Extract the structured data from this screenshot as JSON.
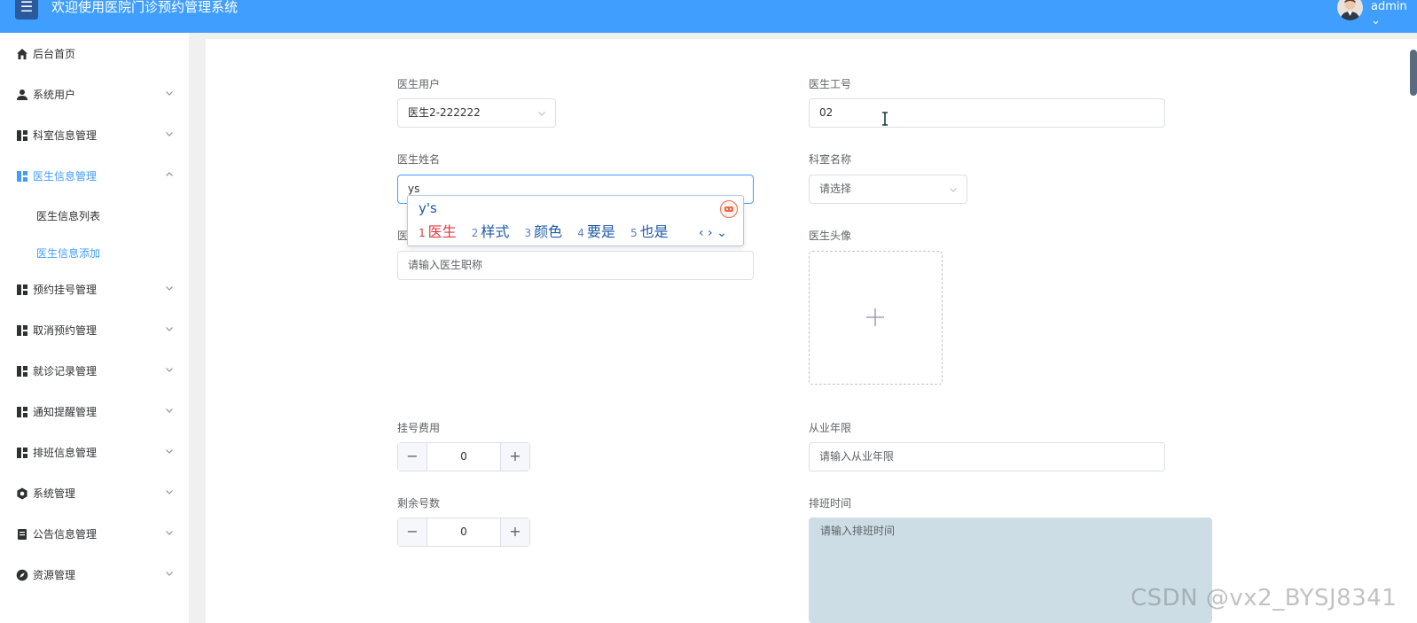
{
  "header": {
    "menu_icon": "☰",
    "title": "欢迎使用医院门诊预约管理系统",
    "user": "admin",
    "user_caret": "⌄"
  },
  "sidebar": {
    "items": [
      {
        "label": "后台首页",
        "icon": "home-icon"
      },
      {
        "label": "系统用户",
        "icon": "user-icon"
      },
      {
        "label": "科室信息管理",
        "icon": "grid-icon"
      },
      {
        "label": "医生信息管理",
        "icon": "grid-icon"
      },
      {
        "label": "预约挂号管理",
        "icon": "grid-icon"
      },
      {
        "label": "取消预约管理",
        "icon": "grid-icon"
      },
      {
        "label": "就诊记录管理",
        "icon": "grid-icon"
      },
      {
        "label": "通知提醒管理",
        "icon": "grid-icon"
      },
      {
        "label": "排班信息管理",
        "icon": "grid-icon"
      },
      {
        "label": "系统管理",
        "icon": "gear-icon"
      },
      {
        "label": "公告信息管理",
        "icon": "document-icon"
      },
      {
        "label": "资源管理",
        "icon": "compass-icon"
      }
    ],
    "sub_items": [
      {
        "label": "医生信息列表"
      },
      {
        "label": "医生信息添加"
      }
    ],
    "accent_color": "#409eff"
  },
  "form": {
    "doctor_user": {
      "label": "医生用户",
      "value": "医生2-222222"
    },
    "doctor_id": {
      "label": "医生工号",
      "value": "02"
    },
    "doctor_name": {
      "label": "医生姓名",
      "value": "ys"
    },
    "department": {
      "label": "科室名称",
      "placeholder": "请选择"
    },
    "doctor_title": {
      "label_partial": "医",
      "placeholder": "请输入医生职称"
    },
    "avatar": {
      "label": "医生头像",
      "plus": "+"
    },
    "fee": {
      "label": "挂号费用",
      "value": "0",
      "minus": "−",
      "plus": "+"
    },
    "years": {
      "label": "从业年限",
      "placeholder": "请输入从业年限"
    },
    "remaining": {
      "label": "剩余号数",
      "value": "0",
      "minus": "−",
      "plus": "+"
    },
    "schedule": {
      "label": "排班时间",
      "placeholder": "请输入排班时间"
    }
  },
  "ime": {
    "composition": "y's",
    "candidates": [
      {
        "num": "1",
        "text": "医生"
      },
      {
        "num": "2",
        "text": "样式"
      },
      {
        "num": "3",
        "text": "颜色"
      },
      {
        "num": "4",
        "text": "要是"
      },
      {
        "num": "5",
        "text": "也是"
      }
    ],
    "nav": "‹ › ⌄"
  },
  "watermark": "CSDN @vx2_BYSJ8341"
}
